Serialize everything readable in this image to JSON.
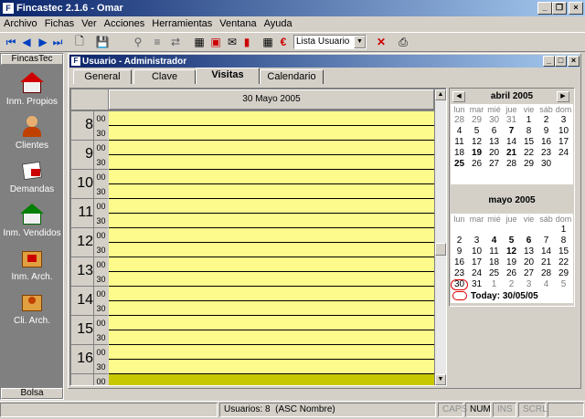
{
  "app": {
    "title": "Fincastec 2.1.6 - Omar"
  },
  "menu": [
    "Archivo",
    "Fichas",
    "Ver",
    "Acciones",
    "Herramientas",
    "Ventana",
    "Ayuda"
  ],
  "toolbar": {
    "combo_value": "Lista Usuario"
  },
  "sidebar": {
    "title": "FincasTec",
    "items": [
      "Inm. Propios",
      "Clientes",
      "Demandas",
      "Inm. Vendidos",
      "Inm. Arch.",
      "Cli. Arch."
    ],
    "footer": "Bolsa"
  },
  "child": {
    "title": "Usuario - Administrador"
  },
  "tabs": [
    "General",
    "Clave",
    "Visitas",
    "Calendario"
  ],
  "schedule": {
    "date": "30 Mayo 2005",
    "hours": [
      "8",
      "9",
      "10",
      "11",
      "12",
      "13",
      "14",
      "15",
      "16"
    ],
    "minutes": [
      "00",
      "30"
    ]
  },
  "calendar": {
    "dow": [
      "lun",
      "mar",
      "mié",
      "jue",
      "vie",
      "sáb",
      "dom"
    ],
    "april": {
      "title": "abril 2005",
      "weeks": [
        [
          "28",
          "29",
          "30",
          "31",
          "1",
          "2",
          "3"
        ],
        [
          "4",
          "5",
          "6",
          "7",
          "8",
          "9",
          "10"
        ],
        [
          "11",
          "12",
          "13",
          "14",
          "15",
          "16",
          "17"
        ],
        [
          "18",
          "19",
          "20",
          "21",
          "22",
          "23",
          "24"
        ],
        [
          "25",
          "26",
          "27",
          "28",
          "29",
          "30",
          ""
        ]
      ]
    },
    "may": {
      "title": "mayo 2005",
      "weeks": [
        [
          "",
          "",
          "",
          "",
          "",
          "",
          "1"
        ],
        [
          "2",
          "3",
          "4",
          "5",
          "6",
          "7",
          "8"
        ],
        [
          "9",
          "10",
          "11",
          "12",
          "13",
          "14",
          "15"
        ],
        [
          "16",
          "17",
          "18",
          "19",
          "20",
          "21",
          "22"
        ],
        [
          "23",
          "24",
          "25",
          "26",
          "27",
          "28",
          "29"
        ],
        [
          "30",
          "31",
          "1",
          "2",
          "3",
          "4",
          "5"
        ]
      ]
    },
    "today": "Today: 30/05/05"
  },
  "status": {
    "users": "Usuarios: 8",
    "order": "(ASC Nombre)",
    "caps": "CAPS",
    "num": "NUM",
    "ins": "INS",
    "scrl": "SCRL"
  }
}
